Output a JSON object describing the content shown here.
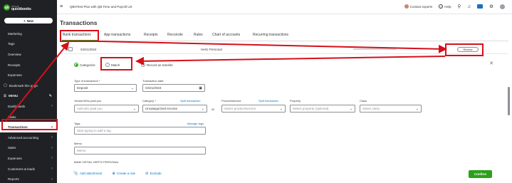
{
  "brand": {
    "intuit": "INTUIT",
    "product": "quickbooks",
    "logo_glyph": "qb"
  },
  "sidebar": {
    "new_label": "New",
    "items": [
      {
        "label": "Marketing"
      },
      {
        "label": "Tags"
      },
      {
        "label": "Overview"
      },
      {
        "label": "Receipts"
      },
      {
        "label": "Expenses"
      }
    ],
    "bookmark_label": "Bookmark this page",
    "menu_label": "MENU",
    "menu_items": [
      {
        "label": "Dashboards"
      },
      {
        "label": "Tasks"
      },
      {
        "label": "Transactions"
      },
      {
        "label": "Advanced accounting"
      },
      {
        "label": "Sales"
      },
      {
        "label": "Expenses"
      },
      {
        "label": "Customers & leads"
      },
      {
        "label": "Reports"
      }
    ],
    "active_item": "Transactions"
  },
  "topbar": {
    "company": "QBOTest Plus with QB Time and Payroll US",
    "contact_experts": "Contact experts",
    "help": "Help",
    "icons": [
      "search-icon",
      "bell-icon",
      "apps-icon",
      "gear-icon",
      "avatar"
    ]
  },
  "page": {
    "title": "Transactions",
    "tabs": [
      "Bank transactions",
      "App transactions",
      "Receipts",
      "Reconcile",
      "Rules",
      "Chart of accounts",
      "Recurring transactions"
    ],
    "active_tab": "Bank transactions"
  },
  "transaction_row": {
    "date": "04/21/2024",
    "payee": "Hertz Personal",
    "review_label": "Review"
  },
  "panel": {
    "radios": [
      {
        "label": "Categorize",
        "selected": true
      },
      {
        "label": "Match",
        "selected": false
      },
      {
        "label": "Record as transfer",
        "selected": false
      }
    ],
    "type_label": "Type of transaction *",
    "type_value": "Deposit",
    "date_label": "Transaction date",
    "date_value": "04/21/2024",
    "vendor_label": "Vendor/Who paid you",
    "vendor_placeholder": "Add who paid you",
    "category_label": "Category *",
    "split_link": "Split transaction",
    "category_value": "Uncategorized Income",
    "or_text": "or",
    "product_label": "Product/service",
    "product_split_link": "Split transaction",
    "product_placeholder": "Select product/service",
    "property_label": "Property",
    "property_placeholder": "Select property (optional)",
    "class_label": "Class",
    "class_placeholder": "Select class",
    "tags_label": "Tags",
    "manage_tags": "Manage tags",
    "tags_placeholder": "Start typing to add a tag",
    "memo_label": "Memo",
    "memo_value": "Memo",
    "bank_detail": "BANK DETAIL HERTZ PERSONAL",
    "add_attachment": "Add attachment",
    "create_rule": "Create a rule",
    "exclude": "Exclude",
    "confirm": "Confirm"
  },
  "colors": {
    "accent_green": "#2ca01c",
    "sidebar_bg": "#1f2125",
    "link_blue": "#0077c5",
    "annotation_red": "#d5101a"
  }
}
